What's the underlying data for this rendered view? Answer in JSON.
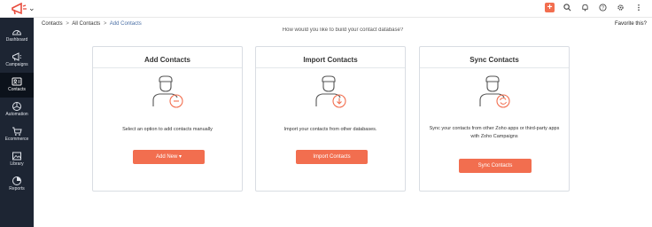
{
  "topbar": {
    "logo_icon": "campaigns-logo-icon",
    "icons": [
      "plus-icon",
      "search-icon",
      "bell-icon",
      "help-icon",
      "gear-icon",
      "more-icon"
    ]
  },
  "sidebar": {
    "items": [
      {
        "label": "Dashboard",
        "icon": "dashboard-icon"
      },
      {
        "label": "Campaigns",
        "icon": "megaphone-icon"
      },
      {
        "label": "Contacts",
        "icon": "contacts-icon",
        "active": true
      },
      {
        "label": "Automation",
        "icon": "automation-icon"
      },
      {
        "label": "Ecommerce",
        "icon": "cart-icon"
      },
      {
        "label": "Library",
        "icon": "library-icon"
      },
      {
        "label": "Reports",
        "icon": "reports-icon"
      }
    ]
  },
  "breadcrumb": {
    "items": [
      "Contacts",
      "All Contacts",
      "Add Contacts"
    ],
    "separator": ">"
  },
  "favorite_label": "Favorite this?",
  "faded_heading": "How would you like to build your contact database?",
  "cards": [
    {
      "title": "Add Contacts",
      "description": "Select an option to add contacts manually",
      "button": "Add New ▾"
    },
    {
      "title": "Import Contacts",
      "description": "Import your contacts from other databases.",
      "button": "Import Contacts"
    },
    {
      "title": "Sync Contacts",
      "description": "Sync your contacts from other Zoho apps or third-party apps with Zoho Campaigns",
      "button": "Sync Contacts"
    }
  ],
  "colors": {
    "accent": "#f26e4f",
    "sidebar": "#1d2533",
    "sidebar_active": "#0c121b"
  }
}
